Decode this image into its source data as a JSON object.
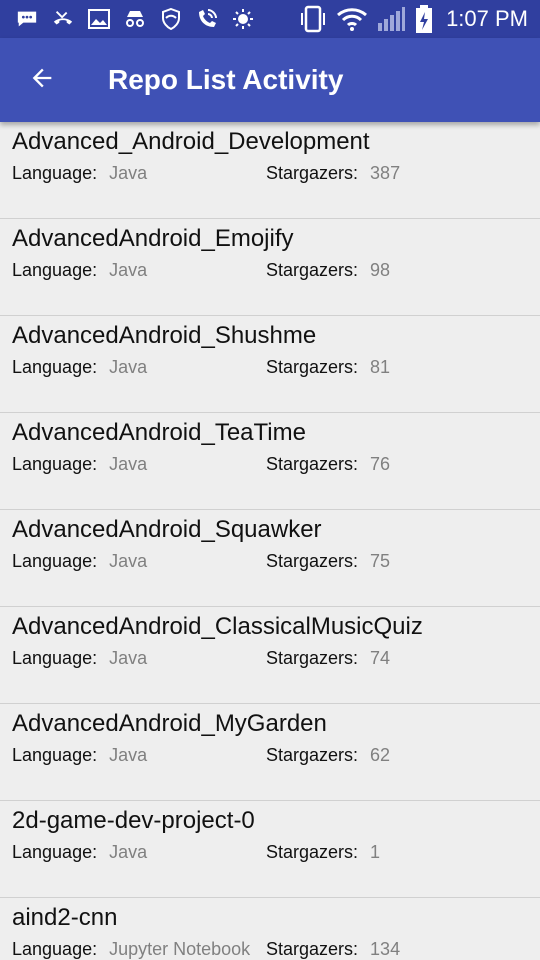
{
  "colors": {
    "status_bar": "#303f9f",
    "app_bar": "#3f51b5",
    "background": "#eeeeee",
    "divider": "#d0d0d0",
    "value_text": "#808080"
  },
  "status_bar": {
    "time": "1:07 PM",
    "icons": [
      "message-icon",
      "missed-call-icon",
      "image-icon",
      "incognito-icon",
      "shield-icon",
      "wifi-calling-icon",
      "brightness-icon",
      "vibrate-icon",
      "wifi-icon",
      "signal-icon",
      "battery-charging-icon"
    ]
  },
  "app_bar": {
    "title": "Repo List Activity",
    "back_icon": "arrow-back-icon"
  },
  "labels": {
    "language": "Language:",
    "stargazers": "Stargazers:"
  },
  "repos": [
    {
      "name": "Advanced_Android_Development",
      "language": "Java",
      "stargazers": "387"
    },
    {
      "name": "AdvancedAndroid_Emojify",
      "language": "Java",
      "stargazers": "98"
    },
    {
      "name": "AdvancedAndroid_Shushme",
      "language": "Java",
      "stargazers": "81"
    },
    {
      "name": "AdvancedAndroid_TeaTime",
      "language": "Java",
      "stargazers": "76"
    },
    {
      "name": "AdvancedAndroid_Squawker",
      "language": "Java",
      "stargazers": "75"
    },
    {
      "name": "AdvancedAndroid_ClassicalMusicQuiz",
      "language": "Java",
      "stargazers": "74"
    },
    {
      "name": "AdvancedAndroid_MyGarden",
      "language": "Java",
      "stargazers": "62"
    },
    {
      "name": "2d-game-dev-project-0",
      "language": "Java",
      "stargazers": "1"
    },
    {
      "name": "aind2-cnn",
      "language": "Jupyter Notebook",
      "stargazers": "134"
    }
  ]
}
